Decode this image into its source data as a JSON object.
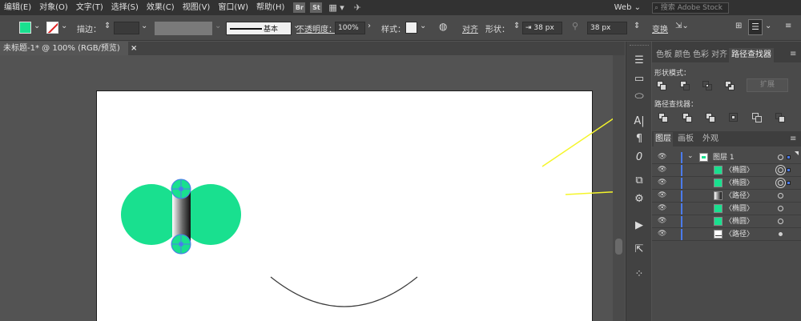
{
  "menubar": {
    "items": [
      "编辑(E)",
      "对象(O)",
      "文字(T)",
      "选择(S)",
      "效果(C)",
      "视图(V)",
      "窗口(W)",
      "帮助(H)"
    ],
    "br": "Br",
    "st": "St",
    "workspace": "Web",
    "search_placeholder": "搜索 Adobe Stock"
  },
  "control": {
    "stroke_label": "描边：",
    "opacity_label": "不透明度：",
    "opacity_value": "100%",
    "style_label": "样式：",
    "brush_label": "基本",
    "align_label": "对齐",
    "shape_label": "形状：",
    "width_value": "38 px",
    "height_value": "38 px",
    "transform_label": "变换"
  },
  "document": {
    "tab_title": "未标题-1* @ 100% (RGB/预览)",
    "close": "×"
  },
  "panel_tabs": [
    "色板",
    "颜色",
    "色彩",
    "对齐",
    "路径查找器"
  ],
  "pathfinder": {
    "shape_modes_label": "形状模式：",
    "expand_label": "扩展",
    "pathfinders_label": "路径查找器："
  },
  "layers_tabs": [
    "图层",
    "画板",
    "外观"
  ],
  "layers": [
    {
      "name": "图层 1",
      "thumb": "layer"
    },
    {
      "name": "〈椭圆〉",
      "thumb": "green"
    },
    {
      "name": "〈椭圆〉",
      "thumb": "green"
    },
    {
      "name": "〈路径〉",
      "thumb": "gradient"
    },
    {
      "name": "〈椭圆〉",
      "thumb": "green"
    },
    {
      "name": "〈椭圆〉",
      "thumb": "green"
    },
    {
      "name": "〈路径〉",
      "thumb": "white"
    }
  ],
  "colors": {
    "fill": "#19e08f",
    "accent": "#4b7bec",
    "arrow": "#f5f52a",
    "artboard": "#ffffff"
  }
}
